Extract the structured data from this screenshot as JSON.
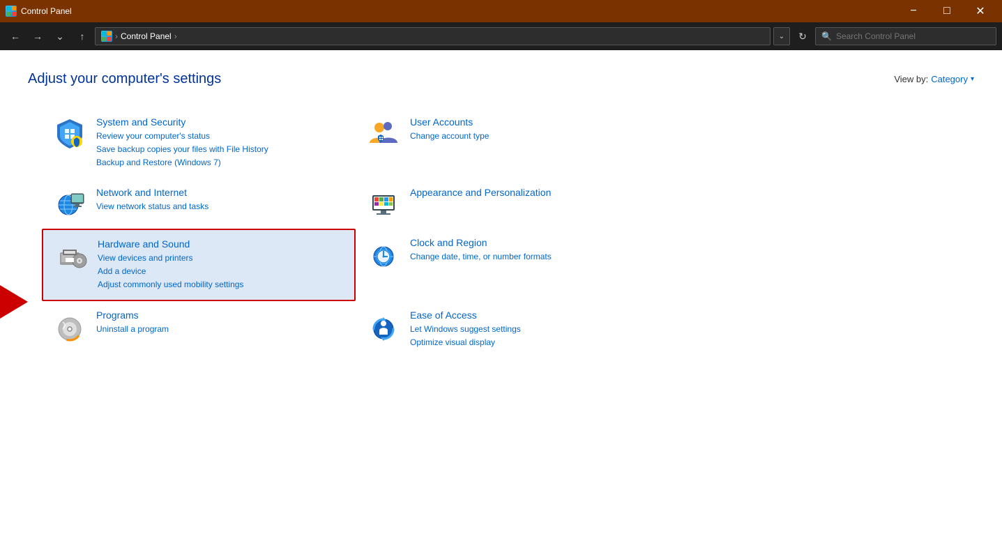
{
  "titlebar": {
    "icon_label": "CP",
    "title": "Control Panel",
    "minimize_label": "−",
    "maximize_label": "□",
    "close_label": "✕"
  },
  "addressbar": {
    "path_icon_alt": "Control Panel icon",
    "path_text": "Control Panel",
    "path_sep": ">",
    "search_placeholder": "Search Control Panel",
    "search_label": "Search Control Panel"
  },
  "main": {
    "page_title": "Adjust your computer's settings",
    "view_by_label": "View by:",
    "view_by_value": "Category",
    "categories": [
      {
        "id": "system-security",
        "title": "System and Security",
        "links": [
          "Review your computer's status",
          "Save backup copies your files with File History",
          "Backup and Restore (Windows 7)"
        ],
        "highlighted": false
      },
      {
        "id": "user-accounts",
        "title": "User Accounts",
        "links": [
          "Change account type"
        ],
        "highlighted": false
      },
      {
        "id": "network-internet",
        "title": "Network and Internet",
        "links": [
          "View network status and tasks"
        ],
        "highlighted": false
      },
      {
        "id": "appearance-personalization",
        "title": "Appearance and Personalization",
        "links": [],
        "highlighted": false
      },
      {
        "id": "hardware-sound",
        "title": "Hardware and Sound",
        "links": [
          "View devices and printers",
          "Add a device",
          "Adjust commonly used mobility settings"
        ],
        "highlighted": true
      },
      {
        "id": "clock-region",
        "title": "Clock and Region",
        "links": [
          "Change date, time, or number formats"
        ],
        "highlighted": false
      },
      {
        "id": "programs",
        "title": "Programs",
        "links": [
          "Uninstall a program"
        ],
        "highlighted": false
      },
      {
        "id": "ease-of-access",
        "title": "Ease of Access",
        "links": [
          "Let Windows suggest settings",
          "Optimize visual display"
        ],
        "highlighted": false
      }
    ]
  }
}
